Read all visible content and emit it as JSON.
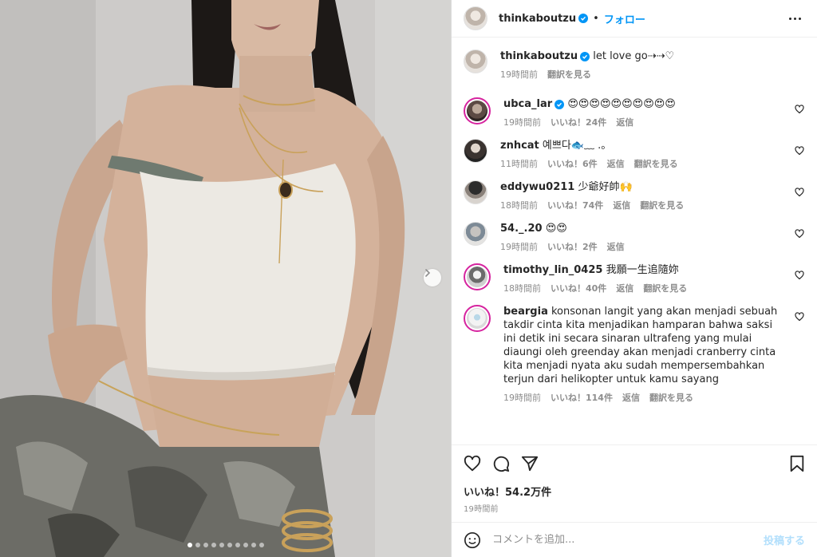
{
  "post": {
    "author": "thinkaboutzu",
    "follow_label": "フォロー",
    "caption": "let love go⇢⇢♡",
    "caption_time": "19時間前",
    "caption_translate": "翻訳を見る",
    "likes_label": "いいね！54.2万件",
    "posted_ago": "19時間前",
    "carousel": {
      "total": 10,
      "current": 1
    }
  },
  "comments": [
    {
      "user": "ubca_lar",
      "verified": true,
      "text": "😍😍😍😍😍😍😍😍😍😍",
      "time": "19時間前",
      "likes": "いいね！24件",
      "reply": "返信",
      "translate": ""
    },
    {
      "user": "znhcat",
      "verified": false,
      "text": "예쁘다🐟﹏ .。",
      "time": "11時間前",
      "likes": "いいね！6件",
      "reply": "返信",
      "translate": "翻訳を見る"
    },
    {
      "user": "eddywu0211",
      "verified": false,
      "text": "少爺好帥🙌",
      "time": "18時間前",
      "likes": "いいね！74件",
      "reply": "返信",
      "translate": "翻訳を見る"
    },
    {
      "user": "54._.20",
      "verified": false,
      "text": "😍😍",
      "time": "19時間前",
      "likes": "いいね！2件",
      "reply": "返信",
      "translate": ""
    },
    {
      "user": "timothy_lin_0425",
      "verified": false,
      "text": "我願一生追隨妳",
      "time": "18時間前",
      "likes": "いいね！40件",
      "reply": "返信",
      "translate": "翻訳を見る"
    },
    {
      "user": "beargia",
      "verified": false,
      "text": "konsonan langit yang akan menjadi sebuah takdir cinta kita menjadikan hamparan bahwa saksi ini detik ini secara sinaran ultrafeng yang mulai diaungi oleh greenday akan menjadi cranberry cinta kita menjadi nyata aku sudah mempersembahkan terjun dari helikopter untuk kamu sayang",
      "time": "19時間前",
      "likes": "いいね！114件",
      "reply": "返信",
      "translate": "翻訳を見る"
    }
  ],
  "composer": {
    "placeholder": "コメントを追加...",
    "post_label": "投稿する"
  },
  "icons": {
    "more": "more-options-icon",
    "verified": "verified-badge-icon",
    "like": "heart-icon",
    "comment": "comment-icon",
    "share": "share-icon",
    "save": "bookmark-icon",
    "emoji": "emoji-icon",
    "next": "chevron-right-icon"
  },
  "colors": {
    "accent": "#0095f6",
    "muted": "#8e8e8e",
    "post_disabled": "#b2dffc"
  }
}
